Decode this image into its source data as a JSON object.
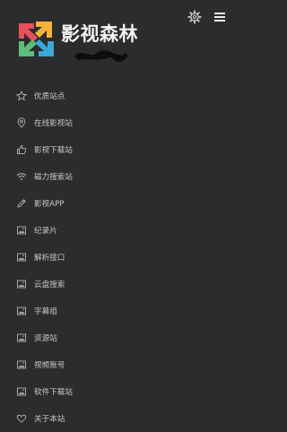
{
  "header": {
    "site_title": "影视森林",
    "logo_colors": [
      "#e8505b",
      "#f4b43a",
      "#3aa8d8",
      "#5bbf7a"
    ]
  },
  "nav": {
    "items": [
      {
        "label": "优质站点",
        "icon": "star-icon"
      },
      {
        "label": "在线影视站",
        "icon": "location-pin-icon"
      },
      {
        "label": "影视下载站",
        "icon": "thumbs-up-icon"
      },
      {
        "label": "磁力搜索站",
        "icon": "wifi-icon"
      },
      {
        "label": "影视APP",
        "icon": "pencil-icon"
      },
      {
        "label": "纪录片",
        "icon": "image-icon"
      },
      {
        "label": "解析接口",
        "icon": "image-icon"
      },
      {
        "label": "云盘搜索",
        "icon": "image-icon"
      },
      {
        "label": "字幕组",
        "icon": "image-icon"
      },
      {
        "label": "资源站",
        "icon": "image-icon"
      },
      {
        "label": "视频账号",
        "icon": "image-icon"
      },
      {
        "label": "软件下载站",
        "icon": "image-icon"
      },
      {
        "label": "关于本站",
        "icon": "heart-icon"
      }
    ]
  }
}
